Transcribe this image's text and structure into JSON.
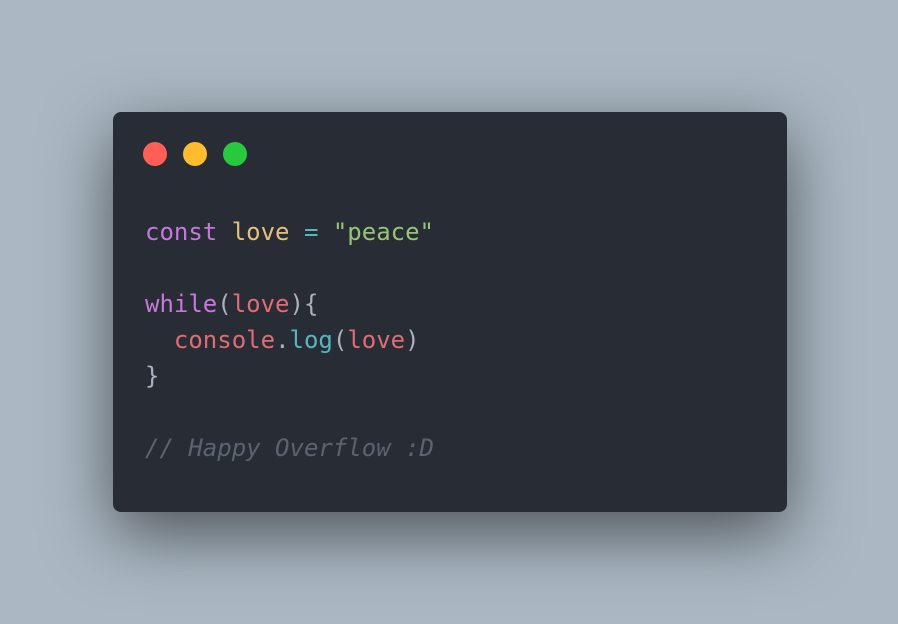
{
  "window": {
    "controls": [
      {
        "name": "close",
        "color": "#ff5f56"
      },
      {
        "name": "minimize",
        "color": "#ffbd2e"
      },
      {
        "name": "zoom",
        "color": "#27c93f"
      }
    ]
  },
  "colors": {
    "background": "#abb8c3",
    "window": "#282c34",
    "keyword": "#c678dd",
    "variable": "#e5c07b",
    "operator": "#56b6c2",
    "string": "#98c379",
    "identifier": "#e06c75",
    "function": "#56b6c2",
    "punctuation": "#abb2bf",
    "comment": "#5c6370"
  },
  "code": {
    "lines": [
      [
        {
          "text": "const",
          "type": "keyword"
        },
        {
          "text": " ",
          "type": "punctuation"
        },
        {
          "text": "love",
          "type": "variable"
        },
        {
          "text": " ",
          "type": "punctuation"
        },
        {
          "text": "=",
          "type": "operator"
        },
        {
          "text": " ",
          "type": "punctuation"
        },
        {
          "text": "\"peace\"",
          "type": "string"
        }
      ],
      [],
      [
        {
          "text": "while",
          "type": "keyword"
        },
        {
          "text": "(",
          "type": "punctuation"
        },
        {
          "text": "love",
          "type": "identifier"
        },
        {
          "text": "){",
          "type": "punctuation"
        }
      ],
      [
        {
          "text": "  ",
          "type": "punctuation"
        },
        {
          "text": "console",
          "type": "identifier"
        },
        {
          "text": ".",
          "type": "punctuation"
        },
        {
          "text": "log",
          "type": "function"
        },
        {
          "text": "(",
          "type": "punctuation"
        },
        {
          "text": "love",
          "type": "identifier"
        },
        {
          "text": ")",
          "type": "punctuation"
        }
      ],
      [
        {
          "text": "}",
          "type": "punctuation"
        }
      ],
      [],
      [
        {
          "text": "// Happy Overflow :D",
          "type": "comment"
        }
      ]
    ]
  }
}
